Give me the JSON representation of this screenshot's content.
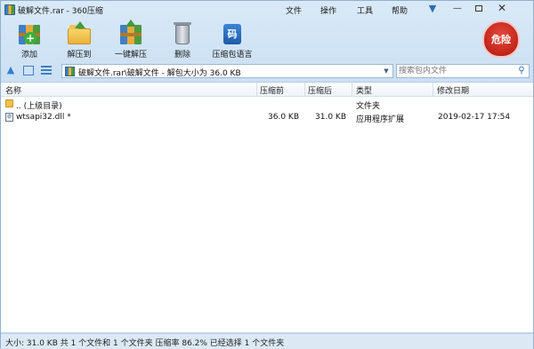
{
  "window": {
    "title": "破解文件.rar - 360压缩"
  },
  "menu": {
    "file": "文件",
    "operate": "操作",
    "tools": "工具",
    "help": "帮助"
  },
  "toolbar": {
    "add": "添加",
    "extract_to": "解压到",
    "one_click_extract": "一键解压",
    "delete": "删除",
    "archive_language": "压缩包语言",
    "lang_icon_glyph": "码",
    "danger_badge": "危险"
  },
  "address": {
    "path": "破解文件.rar\\破解文件 - 解包大小为 36.0 KB",
    "search_placeholder": "搜索包内文件"
  },
  "columns": {
    "name": "名称",
    "before": "压缩前",
    "after": "压缩后",
    "type": "类型",
    "modified": "修改日期"
  },
  "files": [
    {
      "name": ".. (上级目录)",
      "before": "",
      "after": "",
      "type": "文件夹",
      "modified": ""
    },
    {
      "name": "wtsapi32.dll *",
      "before": "36.0 KB",
      "after": "31.0 KB",
      "type": "应用程序扩展",
      "modified": "2019-02-17 17:54"
    }
  ],
  "status": {
    "text": "大小: 31.0 KB 共 1 个文件和 1 个文件夹 压缩率 86.2% 已经选择 1 个文件夹"
  },
  "colors": {
    "danger_red": "#c8251a",
    "window_blue": "#c9dff1"
  }
}
